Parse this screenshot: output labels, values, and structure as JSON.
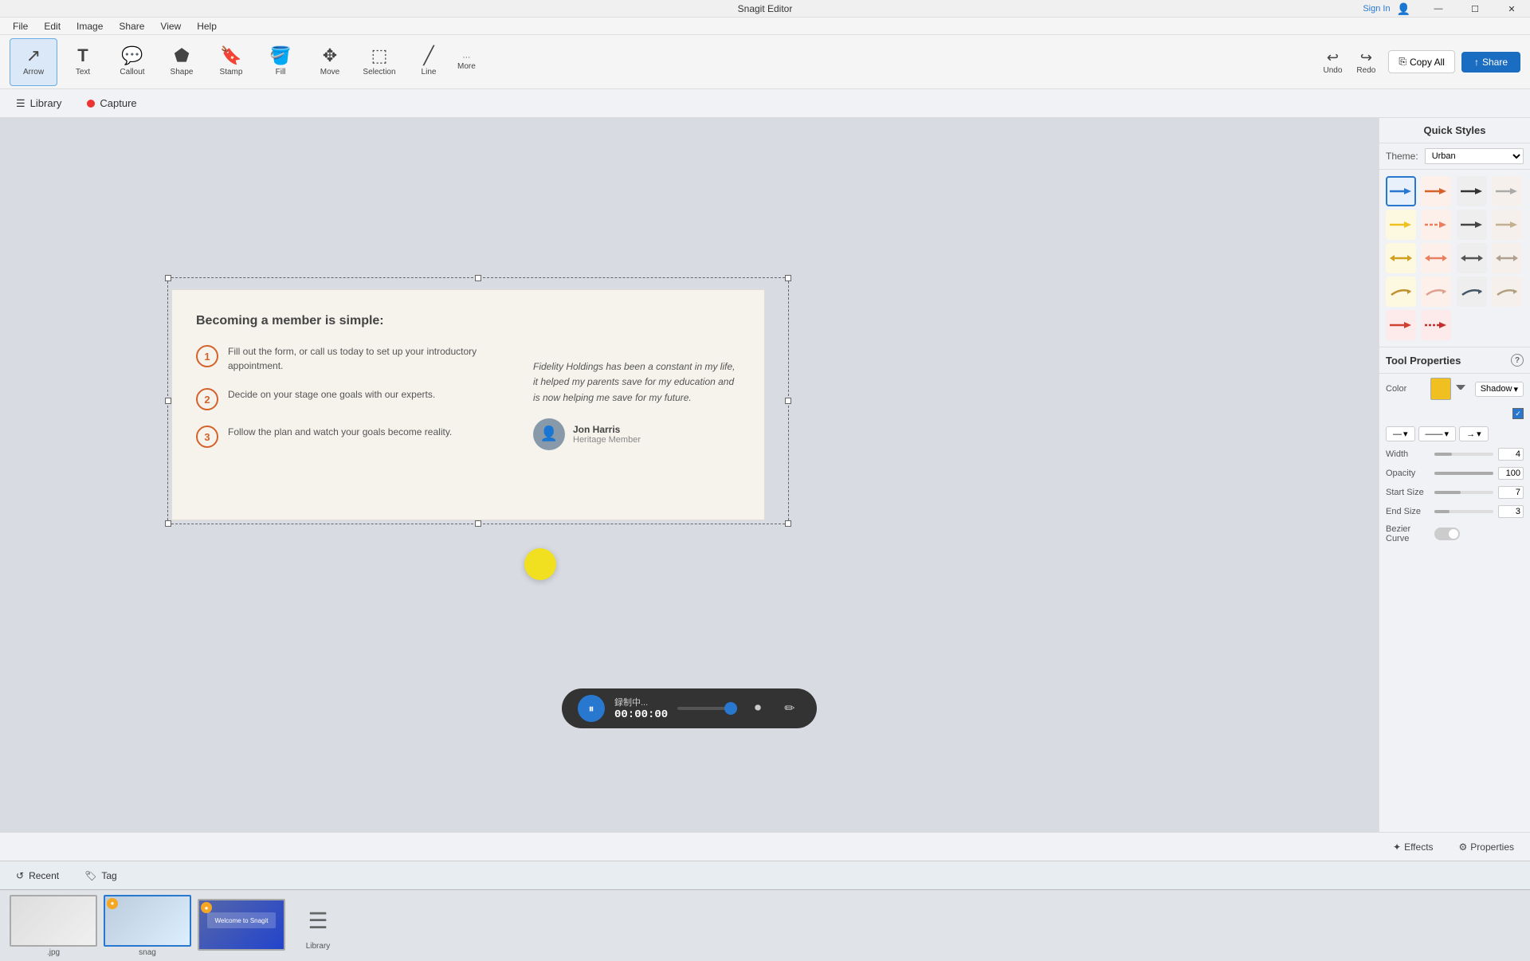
{
  "titleBar": {
    "title": "Snagit Editor",
    "signIn": "Sign In",
    "controls": [
      "—",
      "☐",
      "✕"
    ]
  },
  "menuBar": {
    "items": [
      "File",
      "Edit",
      "Image",
      "Share",
      "View",
      "Help"
    ]
  },
  "toolbar": {
    "tools": [
      {
        "id": "arrow",
        "label": "Arrow",
        "icon": "↗"
      },
      {
        "id": "text",
        "label": "Text",
        "icon": "T"
      },
      {
        "id": "callout",
        "label": "Callout",
        "icon": "💬"
      },
      {
        "id": "shape",
        "label": "Shape",
        "icon": "⬟"
      },
      {
        "id": "stamp",
        "label": "Stamp",
        "icon": "🔖"
      },
      {
        "id": "fill",
        "label": "Fill",
        "icon": "🪣"
      },
      {
        "id": "move",
        "label": "Move",
        "icon": "✥"
      },
      {
        "id": "selection",
        "label": "Selection",
        "icon": "⬚"
      },
      {
        "id": "line",
        "label": "Line",
        "icon": "╱"
      }
    ],
    "more": "More",
    "undo": "Undo",
    "redo": "Redo",
    "copyAll": "Copy All",
    "share": "Share"
  },
  "subToolbar": {
    "library": "Library",
    "capture": "Capture"
  },
  "canvas": {
    "card": {
      "title": "Becoming a member is simple:",
      "steps": [
        {
          "number": "1",
          "text": "Fill out the form, or call us today to set up your introductory appointment."
        },
        {
          "number": "2",
          "text": "Decide on your stage one goals with our experts."
        },
        {
          "number": "3",
          "text": "Follow the plan and watch your goals become reality."
        }
      ],
      "testimonial": "Fidelity Holdings has been a constant in my life, it helped my parents save for my education and is now helping me save for my future.",
      "personName": "Jon Harris",
      "personTitle": "Heritage Member"
    }
  },
  "quickStyles": {
    "title": "Quick Styles",
    "theme": {
      "label": "Theme:",
      "value": "Urban"
    },
    "styles": [
      {
        "color": "#2878d0",
        "type": "solid",
        "selected": true
      },
      {
        "color": "#d4622a",
        "type": "solid"
      },
      {
        "color": "#333",
        "type": "solid"
      },
      {
        "color": "#aaa",
        "type": "solid"
      },
      {
        "color": "#f0c020",
        "type": "solid"
      },
      {
        "color": "#e88060",
        "type": "dashed"
      },
      {
        "color": "#444",
        "type": "solid"
      },
      {
        "color": "#c4b090",
        "type": "solid"
      },
      {
        "color": "#d0a020",
        "type": "double"
      },
      {
        "color": "#e88060",
        "type": "double"
      },
      {
        "color": "#555",
        "type": "double"
      },
      {
        "color": "#b0a090",
        "type": "double"
      },
      {
        "color": "#c09030",
        "type": "multi"
      },
      {
        "color": "#e0a090",
        "type": "multi"
      },
      {
        "color": "#445566",
        "type": "multi"
      },
      {
        "color": "#b0a080",
        "type": "multi"
      },
      {
        "color": "#d04030",
        "type": "solid"
      },
      {
        "color": "#c03030",
        "type": "dashed"
      }
    ]
  },
  "toolProperties": {
    "title": "Tool Properties",
    "colorLabel": "Color",
    "colorValue": "#f0c020",
    "shadowLabel": "Shadow",
    "shadowEnabled": true,
    "widthLabel": "Width",
    "widthValue": "4",
    "opacityLabel": "Opacity",
    "opacityValue": "100",
    "startSizeLabel": "Start Size",
    "startSizeValue": "7",
    "endSizeLabel": "End Size",
    "endSizeValue": "3",
    "bezierLabel": "Bezier Curve",
    "bezierEnabled": false
  },
  "bottomBar": {
    "recent": "Recent",
    "tag": "Tag"
  },
  "filmstrip": {
    "items": [
      {
        "id": "jpg",
        "label": ".jpg",
        "hasBadge": false
      },
      {
        "id": "snag",
        "label": "snag",
        "hasBadge": true
      },
      {
        "id": "snag2",
        "label": "",
        "hasBadge": true
      }
    ],
    "library": "Library"
  },
  "recording": {
    "status": "録制中...",
    "time": "00:00:00"
  },
  "effectsBar": {
    "effects": "Effects",
    "properties": "Properties"
  }
}
